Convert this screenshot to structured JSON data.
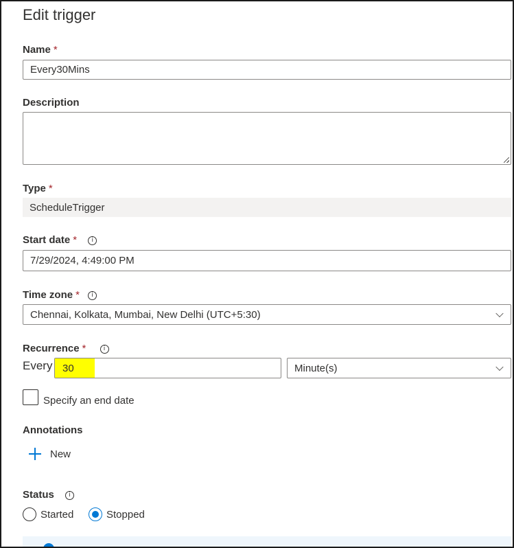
{
  "panel": {
    "title": "Edit trigger"
  },
  "name": {
    "label": "Name",
    "required_mark": "*",
    "value": "Every30Mins"
  },
  "description": {
    "label": "Description",
    "value": ""
  },
  "type": {
    "label": "Type",
    "required_mark": "*",
    "value": "ScheduleTrigger"
  },
  "start_date": {
    "label": "Start date",
    "required_mark": "*",
    "value": "7/29/2024, 4:49:00 PM"
  },
  "time_zone": {
    "label": "Time zone",
    "required_mark": "*",
    "value": "Chennai, Kolkata, Mumbai, New Delhi (UTC+5:30)"
  },
  "recurrence": {
    "label": "Recurrence",
    "required_mark": "*",
    "every_label": "Every",
    "interval_value": "30",
    "unit_value": "Minute(s)",
    "highlight_color": "#ffff00"
  },
  "end_date": {
    "label": "Specify an end date",
    "checked": false
  },
  "annotations": {
    "label": "Annotations",
    "new_label": "New"
  },
  "status": {
    "label": "Status",
    "options": [
      "Started",
      "Stopped"
    ],
    "selected": "Stopped"
  },
  "icons": {
    "info": "info-icon",
    "plus": "plus-icon",
    "chevron": "chevron-down-icon"
  },
  "colors": {
    "accent": "#0078d4",
    "required": "#a4262c"
  }
}
